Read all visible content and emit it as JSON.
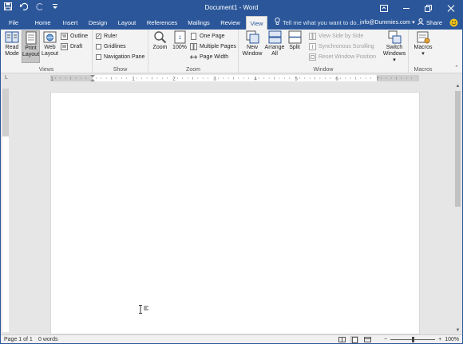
{
  "window": {
    "title": "Document1 - Word",
    "accent": "#2b579a"
  },
  "qat": {
    "icons": [
      "save-icon",
      "undo-icon",
      "redo-icon",
      "customize-qat-icon"
    ]
  },
  "window_controls": [
    "ribbon-display-options-icon",
    "minimize-icon",
    "restore-icon",
    "close-icon"
  ],
  "tabs": [
    {
      "label": "File"
    },
    {
      "label": "Home"
    },
    {
      "label": "Insert"
    },
    {
      "label": "Design"
    },
    {
      "label": "Layout"
    },
    {
      "label": "References"
    },
    {
      "label": "Mailings"
    },
    {
      "label": "Review"
    },
    {
      "label": "View",
      "active": true
    }
  ],
  "tell_me": {
    "placeholder": "Tell me what you want to do..."
  },
  "user": {
    "email": "info@Dummies.com"
  },
  "share": {
    "label": "Share"
  },
  "ribbon": {
    "views": {
      "label": "Views",
      "read_mode": "Read Mode",
      "read_mode_l1": "Read",
      "read_mode_l2": "Mode",
      "print_l1": "Print",
      "print_l2": "Layout",
      "web_l1": "Web",
      "web_l2": "Layout",
      "outline": "Outline",
      "draft": "Draft"
    },
    "show": {
      "label": "Show",
      "ruler": {
        "label": "Ruler",
        "checked": true
      },
      "gridlines": {
        "label": "Gridlines",
        "checked": false
      },
      "navigation_pane": {
        "label": "Navigation Pane",
        "checked": false
      }
    },
    "zoom": {
      "label": "Zoom",
      "zoom": "Zoom",
      "hundred": "100%",
      "one_page": "One Page",
      "multiple_pages": "Multiple Pages",
      "page_width": "Page Width"
    },
    "window": {
      "label": "Window",
      "new_l1": "New",
      "new_l2": "Window",
      "arrange_l1": "Arrange",
      "arrange_l2": "All",
      "split": "Split",
      "side_by_side": "View Side by Side",
      "sync_scrolling": "Synchronous Scrolling",
      "reset_position": "Reset Window Position",
      "switch_l1": "Switch",
      "switch_l2": "Windows"
    },
    "macros": {
      "label": "Macros",
      "macros": "Macros"
    }
  },
  "ruler": {
    "numbers": [
      "1",
      "1",
      "2",
      "3",
      "4",
      "5",
      "6",
      "7"
    ]
  },
  "status": {
    "page": "Page 1 of 1",
    "words": "0 words",
    "zoom": "100%",
    "zoom_level": 1.0
  }
}
